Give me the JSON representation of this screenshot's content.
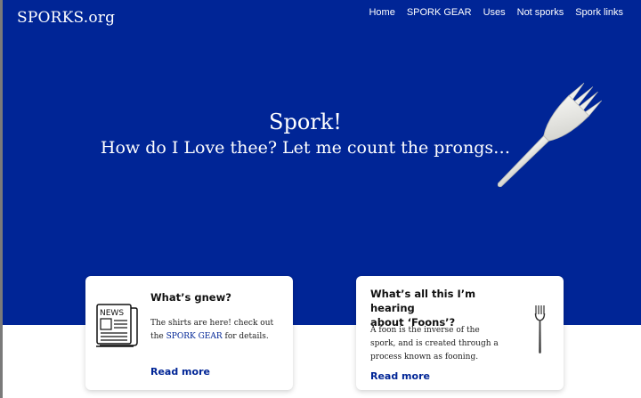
{
  "site": {
    "logo": "SPORKS.org"
  },
  "nav": [
    {
      "label": "Home"
    },
    {
      "label": "SPORK GEAR"
    },
    {
      "label": "Uses"
    },
    {
      "label": "Not sporks"
    },
    {
      "label": "Spork links"
    }
  ],
  "hero": {
    "title": "Spork!",
    "subtitle": "How do I Love thee? Let me count the prongs…",
    "image": "spork-icon"
  },
  "cards": [
    {
      "title": "What’s gnew?",
      "text_before": "The shirts are here! check out the",
      "link": "SPORK GEAR",
      "text_after": "for details.",
      "more": "Read more",
      "icon": "newspaper-icon",
      "icon_label": "NEWS"
    },
    {
      "title_line1": "What’s all this I’m hearing",
      "title_line2": "about ‘Foons’?",
      "text": "A foon is the inverse of the spork, and is created through a process known as fooning.",
      "more": "Read more",
      "icon": "fork-icon"
    }
  ],
  "colors": {
    "hero_bg": "#002596",
    "link": "#002596"
  }
}
